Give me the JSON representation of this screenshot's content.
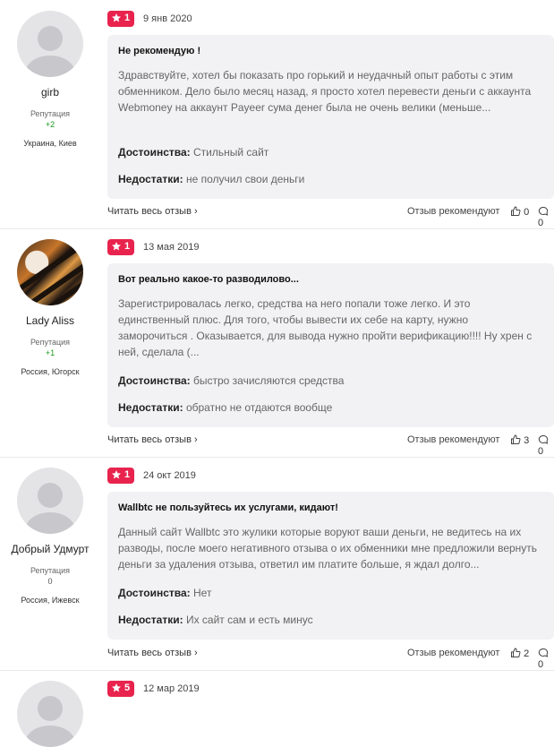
{
  "ui": {
    "read_more": "Читать весь отзыв",
    "recommend_label": "Отзыв рекомендуют",
    "pros_label": "Достоинства:",
    "cons_label": "Недостатки:",
    "reputation_label": "Репутация"
  },
  "reviews": [
    {
      "author": "girb",
      "reputation": "+2",
      "location": "Украина, Киев",
      "rating": "1",
      "date": "9 янв 2020",
      "title": "Не рекомендую !",
      "text": "Здравствуйте, хотел бы показать про горький и неудачный опыт работы с этим обменником. Дело было месяц назад, я просто хотел перевести деньги с аккаунта Webmoney на аккаунт Payeer сума денег была не очень велики (меньше...",
      "pros": "Стильный сайт",
      "cons": "не получил свои деньги",
      "likes": "0",
      "comments": "0"
    },
    {
      "author": "Lady Aliss",
      "reputation": "+1",
      "location": "Россия, Югорск",
      "rating": "1",
      "date": "13 мая 2019",
      "title": "Вот реально какое-то разводилово...",
      "text": "Зарегистрировалась легко, средства на него попали тоже легко. И это единственный плюс. Для того, чтобы вывести их себе на карту, нужно заморочиться . Оказывается, для вывода нужно пройти верификацию!!!! Ну хрен с ней, сделала (...",
      "pros": "быстро зачисляются средства",
      "cons": "обратно не отдаются вообще",
      "likes": "3",
      "comments": "0"
    },
    {
      "author": "Добрый Удмурт",
      "reputation": "0",
      "location": "Россия, Ижевск",
      "rating": "1",
      "date": "24 окт 2019",
      "title": "Wallbtc не пользуйтесь их услугами, кидают!",
      "text": "Данный сайт Wallbtc это жулики которые воруют ваши деньги, не ведитесь на их разводы, после моего негативного отзыва о их обменники мне предложили вернуть деньги за удаления отзыва, ответил им платите больше, я ждал долго...",
      "pros": "Нет",
      "cons": "Их сайт сам и есть минус",
      "likes": "2",
      "comments": "0"
    },
    {
      "rating": "5",
      "date": "12 мар 2019"
    }
  ]
}
